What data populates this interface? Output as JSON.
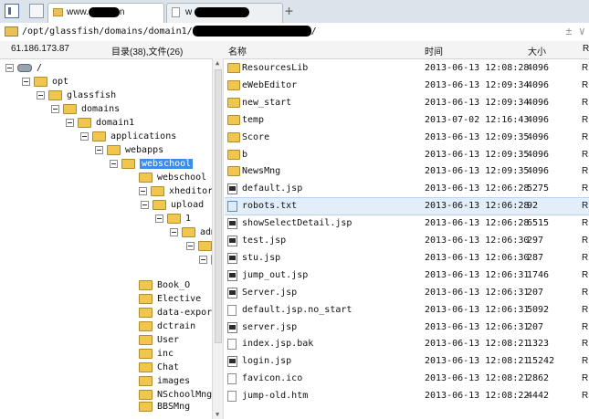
{
  "tabs": [
    {
      "label": "www.",
      "suffix": "n",
      "active": true
    },
    {
      "label": "w",
      "suffix": "",
      "active": false
    }
  ],
  "new_tab_label": "+",
  "path": {
    "prefix": "/opt/glassfish/domains/domain1/",
    "suffix": "/",
    "right_icons": "± ∨"
  },
  "header": {
    "ip": "61.186.173.87",
    "counts": "目录(38),文件(26)",
    "col_name": "名称",
    "col_time": "时间",
    "col_size": "大小",
    "col_r": "R"
  },
  "tree": [
    {
      "label": "/",
      "depth": 0,
      "kind": "drive"
    },
    {
      "label": "opt",
      "depth": 1
    },
    {
      "label": "glassfish",
      "depth": 2
    },
    {
      "label": "domains",
      "depth": 3
    },
    {
      "label": "domain1",
      "depth": 4
    },
    {
      "label": "applications",
      "depth": 5
    },
    {
      "label": "webapps",
      "depth": 6
    },
    {
      "label": "webschool",
      "depth": 7,
      "selected": true
    },
    {
      "label": "webschool",
      "depth": 8,
      "leaf": true
    },
    {
      "label": "xheditor",
      "depth": 8
    },
    {
      "label": "upload",
      "depth": 9
    },
    {
      "label": "1",
      "depth": 10
    },
    {
      "label": "adm",
      "depth": 11
    },
    {
      "label": "",
      "depth": 12
    },
    {
      "label": "",
      "depth": 12
    },
    {
      "label": "",
      "depth": 99
    },
    {
      "label": "Book_O",
      "depth": 8,
      "leaf": true
    },
    {
      "label": "Elective",
      "depth": 8,
      "leaf": true
    },
    {
      "label": "data-export",
      "depth": 8,
      "leaf": true
    },
    {
      "label": "dctrain",
      "depth": 8,
      "leaf": true
    },
    {
      "label": "User",
      "depth": 8,
      "leaf": true
    },
    {
      "label": "inc",
      "depth": 8,
      "leaf": true
    },
    {
      "label": "Chat",
      "depth": 8,
      "leaf": true
    },
    {
      "label": "images",
      "depth": 8,
      "leaf": true
    },
    {
      "label": "NSchoolMng",
      "depth": 8,
      "leaf": true
    },
    {
      "label": "BBSMng",
      "depth": 8,
      "leaf": true
    }
  ],
  "files": [
    {
      "name": "ResourcesLib",
      "time": "2013-06-13 12:08:28",
      "size": "4096",
      "icon": "folder"
    },
    {
      "name": "eWebEditor",
      "time": "2013-06-13 12:09:34",
      "size": "4096",
      "icon": "folder"
    },
    {
      "name": "new_start",
      "time": "2013-06-13 12:09:34",
      "size": "4096",
      "icon": "folder"
    },
    {
      "name": "temp",
      "time": "2013-07-02 12:16:43",
      "size": "4096",
      "icon": "folder"
    },
    {
      "name": "Score",
      "time": "2013-06-13 12:09:35",
      "size": "4096",
      "icon": "folder"
    },
    {
      "name": "b",
      "time": "2013-06-13 12:09:35",
      "size": "4096",
      "icon": "folder"
    },
    {
      "name": "NewsMng",
      "time": "2013-06-13 12:09:35",
      "size": "4096",
      "icon": "folder"
    },
    {
      "name": "default.jsp",
      "time": "2013-06-13 12:06:28",
      "size": "5275",
      "icon": "jsp"
    },
    {
      "name": "robots.txt",
      "time": "2013-06-13 12:06:28",
      "size": "92",
      "icon": "txt",
      "selected": true
    },
    {
      "name": "showSelectDetail.jsp",
      "time": "2013-06-13 12:06:28",
      "size": "6515",
      "icon": "jsp"
    },
    {
      "name": "test.jsp",
      "time": "2013-06-13 12:06:30",
      "size": "297",
      "icon": "jsp"
    },
    {
      "name": "stu.jsp",
      "time": "2013-06-13 12:06:30",
      "size": "287",
      "icon": "jsp"
    },
    {
      "name": "jump_out.jsp",
      "time": "2013-06-13 12:06:31",
      "size": "1746",
      "icon": "jsp"
    },
    {
      "name": "Server.jsp",
      "time": "2013-06-13 12:06:31",
      "size": "207",
      "icon": "jsp"
    },
    {
      "name": "default.jsp.no_start",
      "time": "2013-06-13 12:06:31",
      "size": "5092",
      "icon": "doc"
    },
    {
      "name": "server.jsp",
      "time": "2013-06-13 12:06:31",
      "size": "207",
      "icon": "jsp"
    },
    {
      "name": "index.jsp.bak",
      "time": "2013-06-13 12:08:21",
      "size": "1323",
      "icon": "doc"
    },
    {
      "name": "login.jsp",
      "time": "2013-06-13 12:08:21",
      "size": "15242",
      "icon": "jsp"
    },
    {
      "name": "favicon.ico",
      "time": "2013-06-13 12:08:21",
      "size": "2862",
      "icon": "doc"
    },
    {
      "name": "jump-old.htm",
      "time": "2013-06-13 12:08:22",
      "size": "4442",
      "icon": "doc"
    }
  ],
  "row_suffix": "R"
}
